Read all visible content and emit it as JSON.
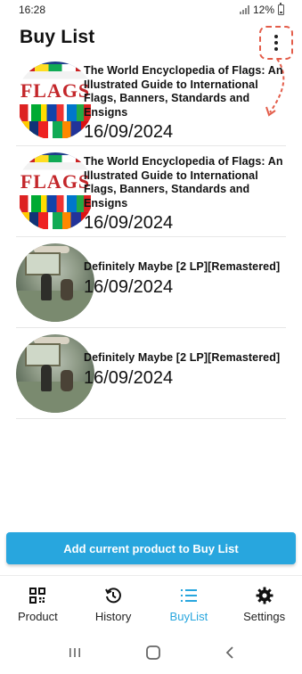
{
  "status_bar": {
    "time": "16:28",
    "battery": "12%"
  },
  "header": {
    "title": "Buy List",
    "more_icon": "more-vertical-icon"
  },
  "items": [
    {
      "name": "The World Encyclopedia of Flags: An Illustrated Guide to International Flags, Banners, Standards and Ensigns",
      "date": "16/09/2024",
      "image": "book-cover",
      "cover_word": "FLAGS"
    },
    {
      "name": "The World Encyclopedia of Flags: An Illustrated Guide to International Flags, Banners, Standards and Ensigns",
      "date": "16/09/2024",
      "image": "book-cover",
      "cover_word": "FLAGS"
    },
    {
      "name": "Definitely Maybe [2 LP][Remastered]",
      "date": "16/09/2024",
      "image": "album-cover"
    },
    {
      "name": "Definitely Maybe [2 LP][Remastered]",
      "date": "16/09/2024",
      "image": "album-cover"
    }
  ],
  "add_button": {
    "label": "Add current product to Buy List"
  },
  "nav": [
    {
      "label": "Product",
      "icon": "qr-code-icon",
      "active": false
    },
    {
      "label": "History",
      "icon": "history-icon",
      "active": false
    },
    {
      "label": "BuyList",
      "icon": "list-icon",
      "active": true
    },
    {
      "label": "Settings",
      "icon": "gear-icon",
      "active": false
    }
  ],
  "colors": {
    "accent": "#28a6de",
    "annotation": "#e35d4a"
  }
}
